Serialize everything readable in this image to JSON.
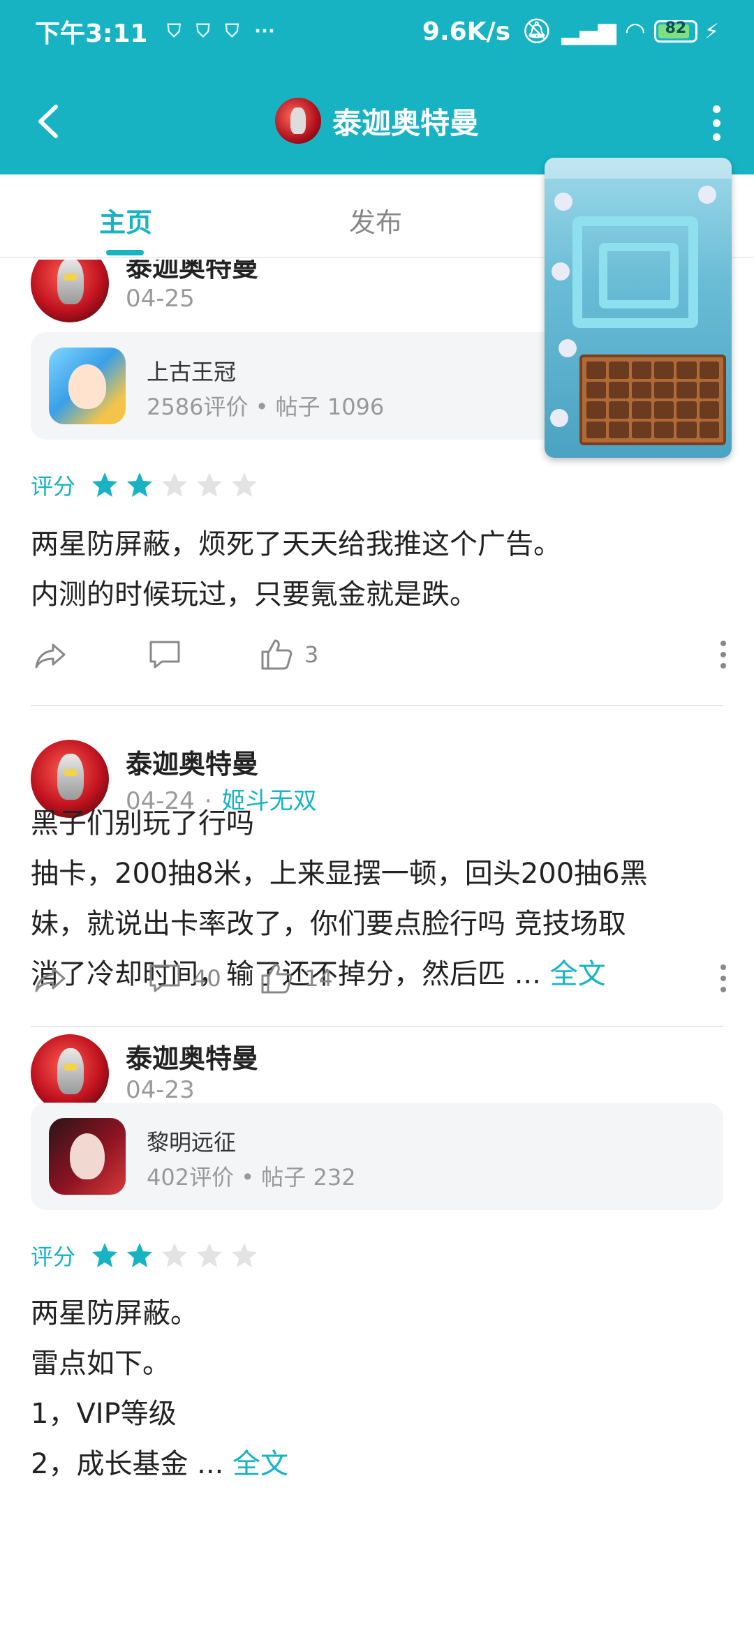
{
  "status_bar": {
    "time": "下午3:11",
    "dots": "···",
    "net_speed": "9.6K/s",
    "battery": "82"
  },
  "app_bar": {
    "title": "泰迦奥特曼"
  },
  "tabs": [
    {
      "label": "主页",
      "active": true
    },
    {
      "label": "发布",
      "active": false
    }
  ],
  "colors": {
    "accent": "#17b3c3",
    "star_on": "#17b3c3",
    "star_off": "#e3e3e3"
  },
  "posts": [
    {
      "author": "泰迦奥特曼",
      "date": "04-25",
      "game": {
        "name": "上古王冠",
        "stats": "2586评价 • 帖子 1096"
      },
      "rating_label": "评分",
      "rating": 2,
      "lines": [
        "两星防屏蔽，烦死了天天给我推这个广告。",
        "内测的时候玩过，只要氪金就是跌。"
      ],
      "comments": "",
      "likes": "3"
    },
    {
      "author": "泰迦奥特曼",
      "date": "04-24",
      "tag": "姬斗无双",
      "lines": [
        "黑子们别玩了行吗",
        "抽卡，200抽8米，上来显摆一顿，回头200抽6黑",
        "妹，就说出卡率改了，你们要点脸行吗 竞技场取",
        "消了冷却时间，输了还不掉分，然后匹 ... "
      ],
      "full_text": "全文",
      "comments": "40",
      "likes": "14"
    },
    {
      "author": "泰迦奥特曼",
      "date": "04-23",
      "game": {
        "name": "黎明远征",
        "stats": "402评价 • 帖子 232"
      },
      "rating_label": "评分",
      "rating": 2,
      "lines": [
        "两星防屏蔽。",
        "雷点如下。",
        "1，VIP等级",
        "2，成长基金 ... "
      ],
      "full_text": "全文"
    }
  ]
}
